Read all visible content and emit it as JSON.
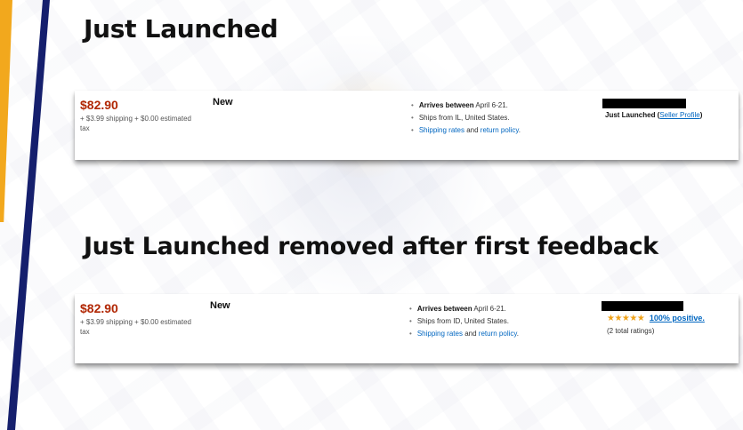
{
  "slide": {
    "heading_top": "Just Launched",
    "heading_bottom": "Just Launched removed after first feedback"
  },
  "listings": [
    {
      "price": "$82.90",
      "shipping": "+ $3.99 shipping + $0.00 estimated tax",
      "condition": "New",
      "arrives_label": "Arrives between",
      "arrives_dates": "April 6-21.",
      "ships_from": "Ships from IL, United States.",
      "shipping_rates_link": "Shipping rates",
      "and_text": "and",
      "return_policy_link": "return policy",
      "seller_badge": "Just Launched",
      "seller_profile_link": "Seller Profile"
    },
    {
      "price": "$82.90",
      "shipping": "+ $3.99 shipping + $0.00 estimated tax",
      "condition": "New",
      "arrives_label": "Arrives between",
      "arrives_dates": "April 6-21.",
      "ships_from": "Ships from ID, United States.",
      "shipping_rates_link": "Shipping rates",
      "and_text": "and",
      "return_policy_link": "return policy",
      "stars": "★★★★★",
      "rating_value": 5,
      "positive_link": "100% positive.",
      "total_ratings": "(2 total ratings)"
    }
  ],
  "colors": {
    "price": "#b12704",
    "link": "#0066c0",
    "stars": "#f0a31a",
    "stripe_orange": "#f2a81d",
    "stripe_navy": "#151f6d"
  }
}
